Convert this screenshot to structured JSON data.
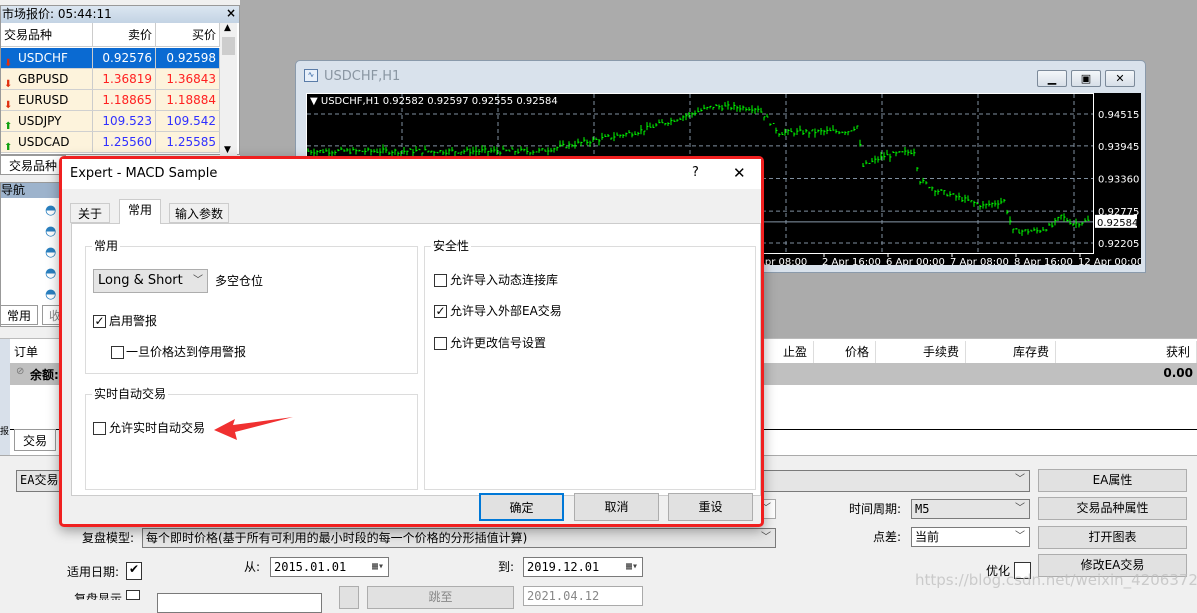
{
  "market_watch": {
    "title": "市场报价: 05:44:11",
    "headers": [
      "交易品种",
      "卖价",
      "买价"
    ],
    "rows": [
      {
        "symbol": "USDCHF",
        "bid": "0.92576",
        "ask": "0.92598",
        "dir": "down",
        "selected": true
      },
      {
        "symbol": "GBPUSD",
        "bid": "1.36819",
        "ask": "1.36843",
        "dir": "down"
      },
      {
        "symbol": "EURUSD",
        "bid": "1.18865",
        "ask": "1.18884",
        "dir": "down"
      },
      {
        "symbol": "USDJPY",
        "bid": "109.523",
        "ask": "109.542",
        "dir": "up"
      },
      {
        "symbol": "USDCAD",
        "bid": "1.25560",
        "ask": "1.25585",
        "dir": "up"
      }
    ],
    "tab": "交易品种",
    "close": "×"
  },
  "colors": {
    "down": "#ff2020",
    "up": "#3030ff",
    "bar": "#00ff00",
    "dialog_border": "#f02020"
  },
  "navigator": {
    "title": "导航",
    "tab": "常用",
    "tab2": "收"
  },
  "chart_window": {
    "title": "USDCHF,H1",
    "info": "USDCHF,H1  0.92582 0.92597 0.92555 0.92584",
    "price_labels": [
      "0.94515",
      "0.93945",
      "0.93360",
      "0.92775",
      "0.92205"
    ],
    "current_price": "0.92584",
    "time_labels": [
      "Apr 08:00",
      "2 Apr 16:00",
      "6 Apr 00:00",
      "7 Apr 08:00",
      "8 Apr 16:00",
      "12 Apr 00:00"
    ],
    "price_path": [
      [
        0,
        0.9385
      ],
      [
        77,
        0.9385
      ],
      [
        110,
        0.942
      ],
      [
        135,
        0.9465
      ],
      [
        150,
        0.9462
      ],
      [
        157,
        0.9418
      ],
      [
        180,
        0.9421
      ],
      [
        183,
        0.943
      ],
      [
        185,
        0.9358
      ],
      [
        192,
        0.9376
      ],
      [
        202,
        0.9385
      ],
      [
        204,
        0.9332
      ],
      [
        210,
        0.9314
      ],
      [
        220,
        0.9296
      ],
      [
        225,
        0.9287
      ],
      [
        232,
        0.9296
      ],
      [
        235,
        0.9242
      ],
      [
        243,
        0.9242
      ],
      [
        248,
        0.9251
      ],
      [
        251,
        0.9269
      ],
      [
        255,
        0.9255
      ],
      [
        260,
        0.926
      ]
    ]
  },
  "terminal": {
    "col_order": "订单",
    "sep": "/",
    "headers": [
      "止盈",
      "价格",
      "手续费",
      "库存费",
      "获利"
    ],
    "balance_label": "余额:",
    "profit": "0.00",
    "tab": "交易",
    "side_tab": "报"
  },
  "tester": {
    "ea_label": "EA交易",
    "model_label": "复盘模型:",
    "model_value": "每个即时价格(基于所有可利用的最小时段的每一个价格的分形插值计算)",
    "use_date_label": "适用日期:",
    "from_label": "从:",
    "from": "2015.01.01",
    "to_label": "到:",
    "to": "2019.12.01",
    "visual_label": "复盘显示",
    "skip_btn": "跳至",
    "skip_date": "2021.04.12",
    "period_label": "时间周期:",
    "period": "M5",
    "spread_label": "点差:",
    "spread": "当前",
    "optimize_label": "优化",
    "buttons": [
      "EA属性",
      "交易品种属性",
      "打开图表",
      "修改EA交易"
    ]
  },
  "dialog": {
    "title": "Expert - MACD Sample",
    "help": "?",
    "close": "✕",
    "tabs": [
      "关于",
      "常用",
      "输入参数"
    ],
    "common_group": "常用",
    "position_select": "Long & Short",
    "position_label": "多空仓位",
    "enable_alerts": "启用警报",
    "disable_alert_once": "一旦价格达到停用警报",
    "live_group": "实时自动交易",
    "allow_live": "允许实时自动交易",
    "security_group": "安全性",
    "allow_dll": "允许导入动态连接库",
    "allow_ex": "允许导入外部EA交易",
    "allow_signal": "允许更改信号设置",
    "ok": "确定",
    "cancel": "取消",
    "reset": "重设"
  },
  "watermark": "https://blog.csdn.net/weixin_42063726"
}
